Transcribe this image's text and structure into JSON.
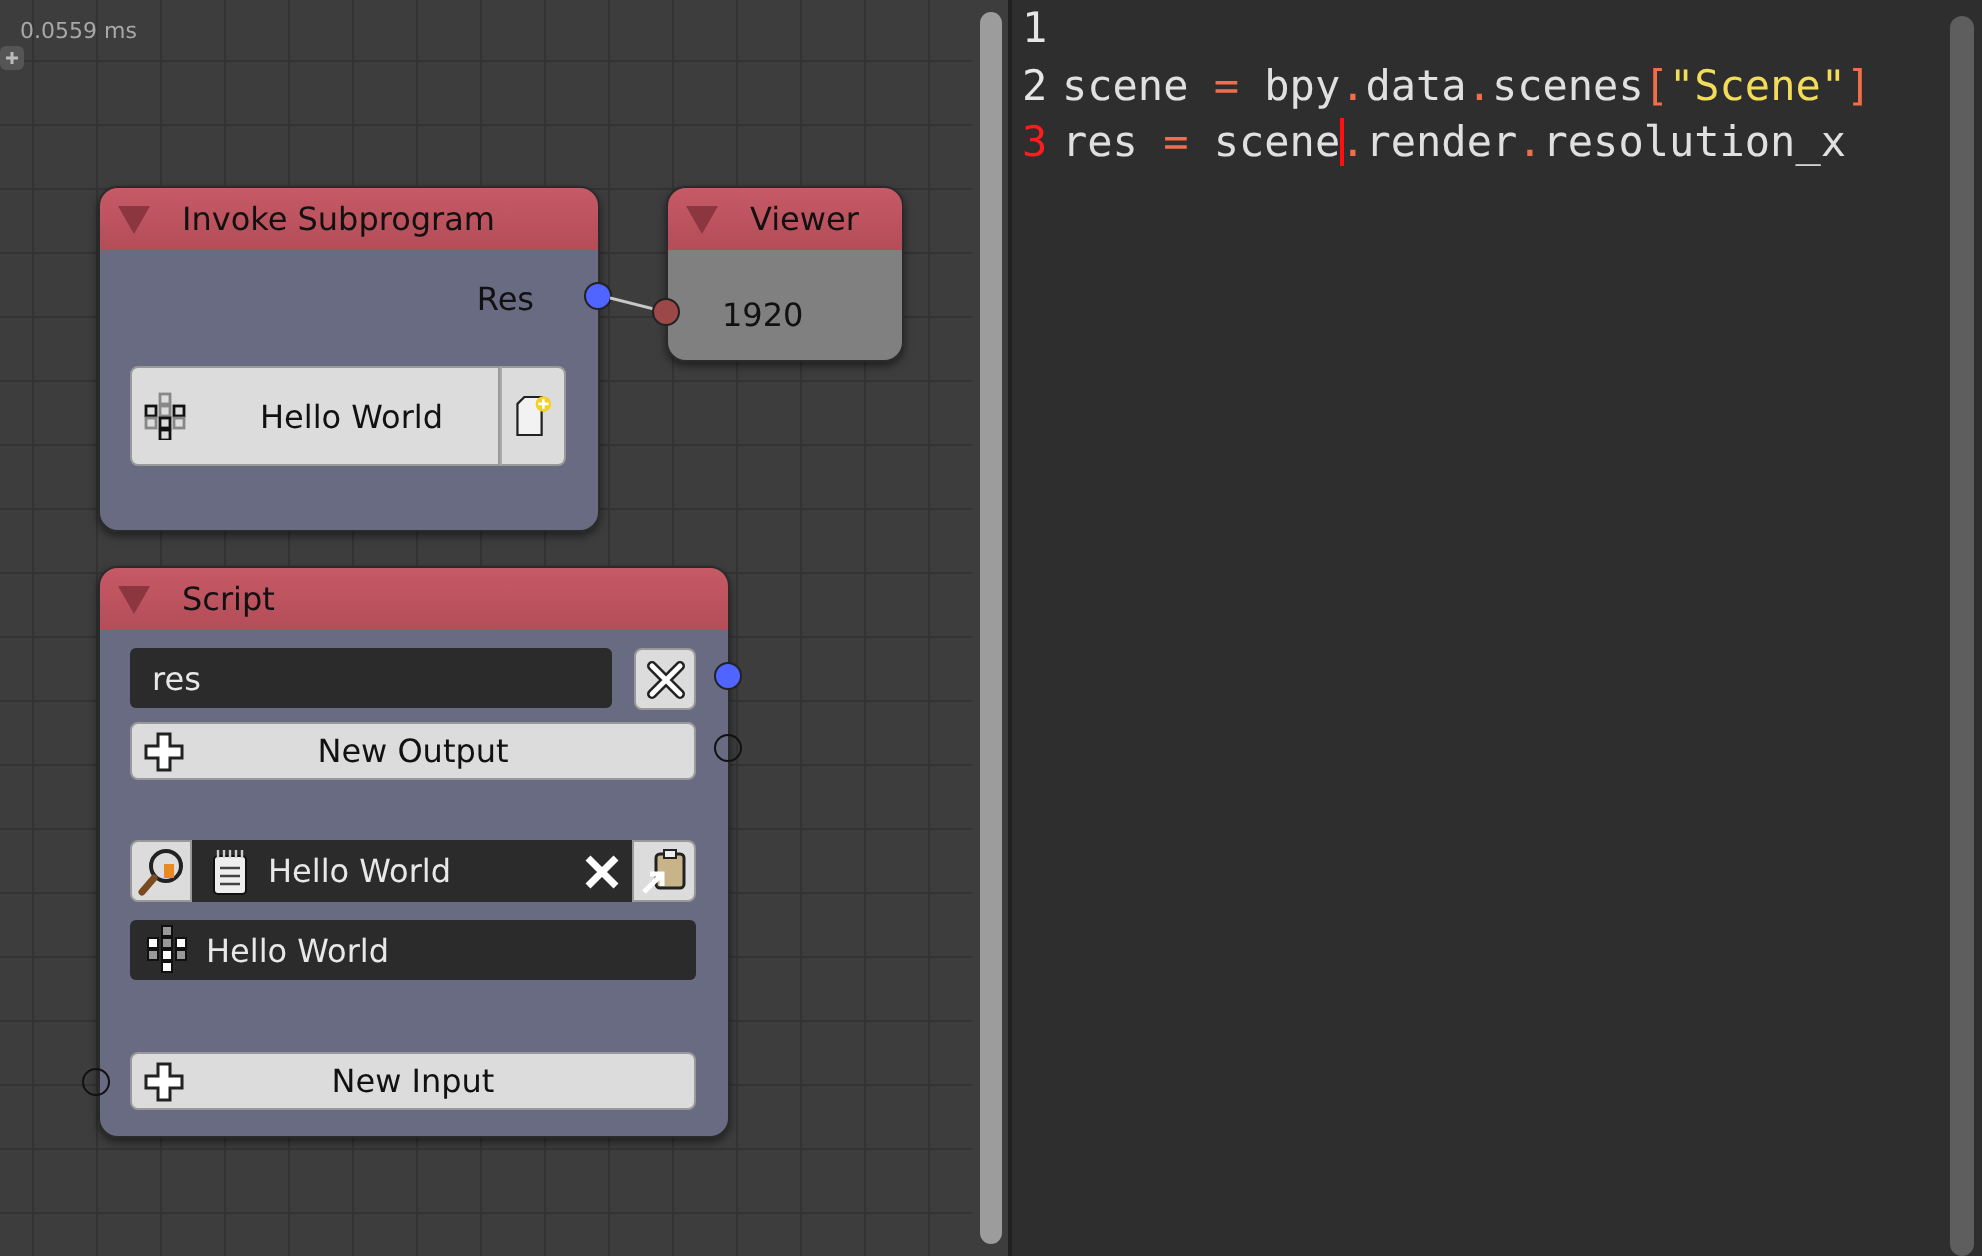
{
  "timing": "0.0559 ms",
  "nodes": [
    {
      "kind": "invoke",
      "title": "Invoke Subprogram",
      "output": "Res",
      "subprogram": "Hello World"
    },
    {
      "kind": "viewer",
      "title": "Viewer",
      "value": "1920"
    },
    {
      "kind": "script",
      "title": "Script",
      "output_name": "res",
      "new_output": "New Output",
      "text_block": "Hello World",
      "subprogram": "Hello World",
      "new_input": "New Input"
    }
  ],
  "code": {
    "lines": [
      {
        "number": "1",
        "current": false
      },
      {
        "number": "2",
        "current": false,
        "tokens": [
          {
            "kind": "plain",
            "text": "scene "
          },
          {
            "kind": "op",
            "text": "="
          },
          {
            "kind": "plain",
            "text": " bpy"
          },
          {
            "kind": "op",
            "text": "."
          },
          {
            "kind": "plain",
            "text": "data"
          },
          {
            "kind": "op",
            "text": "."
          },
          {
            "kind": "plain",
            "text": "scenes"
          },
          {
            "kind": "op",
            "text": "["
          },
          {
            "kind": "string",
            "text": "\"Scene\""
          },
          {
            "kind": "op",
            "text": "]"
          }
        ]
      },
      {
        "number": "3",
        "current": true,
        "tokens": [
          {
            "kind": "plain",
            "text": "res "
          },
          {
            "kind": "op",
            "text": "="
          },
          {
            "kind": "plain",
            "text": " scene"
          },
          {
            "kind": "cursor"
          },
          {
            "kind": "op",
            "text": "."
          },
          {
            "kind": "plain",
            "text": "render"
          },
          {
            "kind": "op",
            "text": "."
          },
          {
            "kind": "plain",
            "text": "resolution_x"
          }
        ]
      }
    ]
  }
}
